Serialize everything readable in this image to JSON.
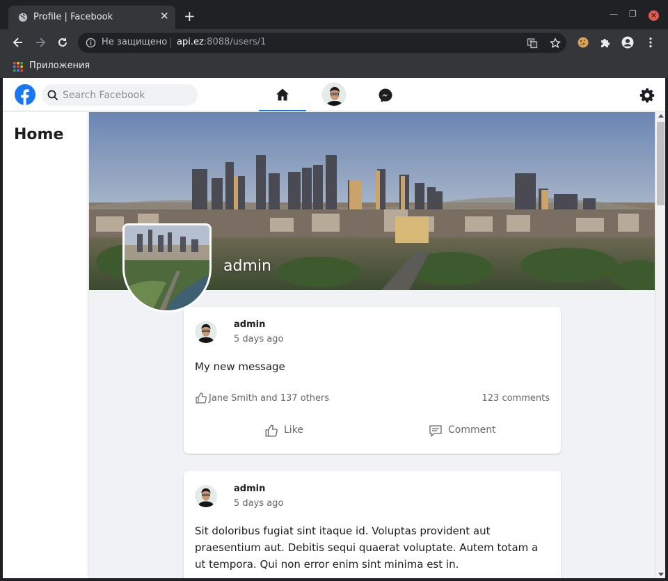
{
  "browser": {
    "tab_title": "Profile | Facebook",
    "tab_close": "✕",
    "new_tab": "+",
    "security_label": "Не защищено",
    "url_host": "api.ez",
    "url_path": ":8088/users/1",
    "bookmark_apps_label": "Приложения",
    "win_minimize": "—",
    "win_restore": "❐",
    "win_close": "✕",
    "colors": {
      "frame": "#202124",
      "toolbar": "#35363a"
    }
  },
  "header": {
    "search_placeholder": "Search Facebook",
    "icons": [
      "facebook-logo",
      "search-icon",
      "home-icon",
      "avatar",
      "messenger-icon",
      "gear-icon"
    ],
    "accent": "#1877f2"
  },
  "sidebar": {
    "title": "Home"
  },
  "profile": {
    "name": "admin"
  },
  "posts": [
    {
      "author": "admin",
      "time": "5 days ago",
      "text": "My new message",
      "likes": "Jane Smith and 137 others",
      "comments": "123 comments",
      "like_label": "Like",
      "comment_label": "Comment"
    },
    {
      "author": "admin",
      "time": "5 days ago",
      "text": "Sit doloribus fugiat sint itaque id. Voluptas provident aut praesentium aut. Debitis sequi quaerat voluptate. Autem totam a ut tempora. Qui non error enim sint minima est in."
    }
  ]
}
